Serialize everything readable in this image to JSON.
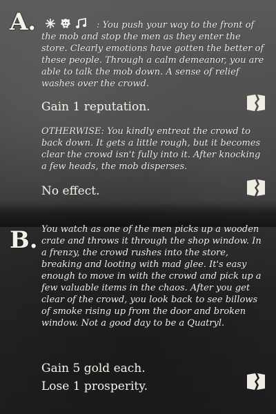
{
  "card": {
    "option_a": {
      "letter": "A.",
      "icons": [
        "sunburst-icon",
        "lion-mask-icon",
        "music-note-icon"
      ],
      "text": ": You push your way to the front of the mob and stop the men as they enter the store. Clearly emotions have gotten the better of these people. Through a calm demeanor, you are able to talk the mob down. A sense of relief washes over the crowd.",
      "effect": "Gain 1 reputation.",
      "otherwise_label": "OTHERWISE:",
      "otherwise_text": " You kindly entreat the crowd to back down. It gets a little rough, but it becomes clear the crowd isn't fully into it. After knocking a few heads, the mob disperses.",
      "otherwise_effect": "No effect."
    },
    "option_b": {
      "letter": "B.",
      "text": "You watch as one of the men picks up a wooden crate and throws it through the shop window. In a frenzy, the crowd rushes into the store, breaking and looting with mad glee. It's easy enough to move in with the crowd and pick up a few valuable items in the chaos. After you get clear of the crowd, you look back to see billows of smoke rising up from the door and broken window. Not a good day to be a Quatryl.",
      "effect_1": "Gain 5 gold each.",
      "effect_2": "Lose 1 prosperity."
    },
    "colors": {
      "text": "#f2efe6",
      "bg_top": "#5a5a5a",
      "bg_bottom": "#1f1f1f"
    }
  }
}
